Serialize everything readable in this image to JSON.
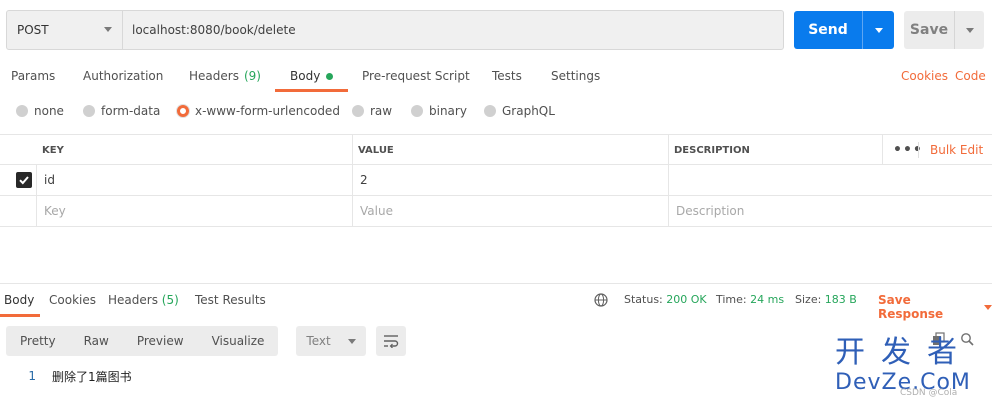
{
  "request": {
    "method": "POST",
    "url": "localhost:8080/book/delete",
    "send_label": "Send",
    "save_label": "Save"
  },
  "req_tabs": {
    "params": "Params",
    "authorization": "Authorization",
    "headers": "Headers",
    "headers_count": "(9)",
    "body": "Body",
    "prerequest": "Pre-request Script",
    "tests": "Tests",
    "settings": "Settings",
    "cookies": "Cookies",
    "code": "Code"
  },
  "body_types": {
    "none": "none",
    "form_data": "form-data",
    "urlencoded": "x-www-form-urlencoded",
    "raw": "raw",
    "binary": "binary",
    "graphql": "GraphQL",
    "selected": "x-www-form-urlencoded"
  },
  "params_table": {
    "headers": {
      "key": "KEY",
      "value": "VALUE",
      "description": "DESCRIPTION"
    },
    "bulk_edit": "Bulk Edit",
    "more": "•••",
    "rows": [
      {
        "checked": true,
        "key": "id",
        "value": "2",
        "description": ""
      }
    ],
    "placeholder": {
      "key": "Key",
      "value": "Value",
      "description": "Description"
    }
  },
  "response": {
    "tabs": {
      "body": "Body",
      "cookies": "Cookies",
      "headers": "Headers",
      "headers_count": "(5)",
      "test_results": "Test Results"
    },
    "status_label": "Status:",
    "status_value": "200 OK",
    "time_label": "Time:",
    "time_value": "24 ms",
    "size_label": "Size:",
    "size_value": "183 B",
    "save_response": "Save Response",
    "view_modes": {
      "pretty": "Pretty",
      "raw": "Raw",
      "preview": "Preview",
      "visualize": "Visualize"
    },
    "format": "Text",
    "lines": [
      {
        "num": "1",
        "text": "删除了1篇图书"
      }
    ]
  },
  "watermark": {
    "cn": "开发者",
    "en": "DevZe.CoM",
    "small": "CSDN @Cola"
  },
  "colors": {
    "accent": "#f26b3a",
    "send": "#097bed",
    "success": "#26a65b"
  }
}
